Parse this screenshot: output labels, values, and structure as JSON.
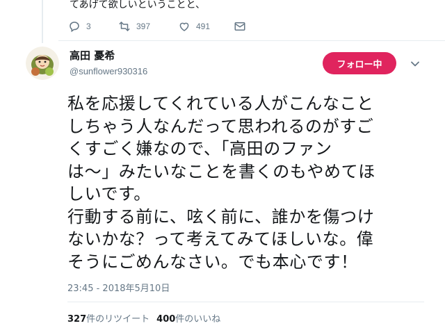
{
  "previous_tweet": {
    "text_fragment": "てあげて欲しいということと、",
    "actions": {
      "reply_count": "3",
      "retweet_count": "397",
      "like_count": "491"
    }
  },
  "tweet": {
    "author": {
      "name": "高田 憂希",
      "handle": "@sunflower930316"
    },
    "follow_button_label": "フォロー中",
    "body_lines": [
      "私を応援してくれている人がこんなこと",
      "しちゃう人なんだって思われるのがすご",
      "くすごく嫌なので、「高田のファン",
      "は～」みたいなことを書くのもやめてほ",
      "しいです。",
      "行動する前に、呟く前に、誰かを傷つけ",
      "ないかな？って考えてみてほしいな。偉",
      "そうにごめんなさい。でも本心です！"
    ],
    "timestamp": "23:45 - 2018年5月10日",
    "stats": {
      "retweets_num": "327",
      "retweets_label": "件のリツイート",
      "likes_num": "400",
      "likes_label": "件のいいね"
    }
  },
  "icons": {
    "reply": "reply-icon",
    "retweet": "retweet-icon",
    "like": "heart-icon",
    "dm": "envelope-icon",
    "caret": "chevron-down-icon"
  },
  "colors": {
    "follow_button_bg": "#e0245e",
    "muted_text": "#657786",
    "primary_text": "#14171a"
  }
}
